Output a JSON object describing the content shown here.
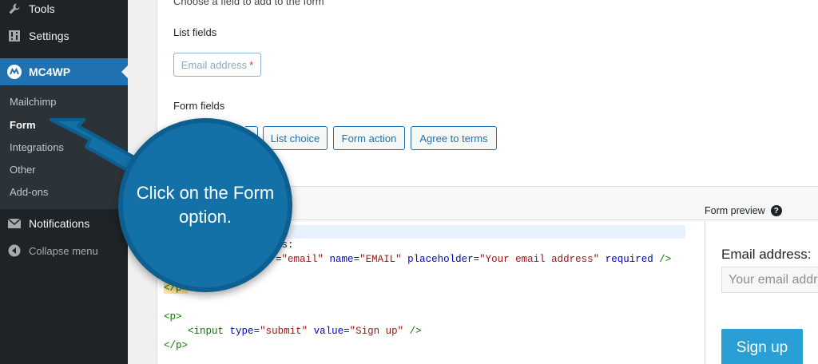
{
  "sidebar": {
    "items": [
      {
        "label": "Tools",
        "icon": "wrench-icon"
      },
      {
        "label": "Settings",
        "icon": "settings-sliders-icon"
      },
      {
        "label": "MC4WP",
        "icon": "mc4wp-logo-icon"
      },
      {
        "label": "Notifications",
        "icon": "envelope-icon"
      }
    ],
    "submenu": [
      "Mailchimp",
      "Form",
      "Integrations",
      "Other",
      "Add-ons"
    ],
    "collapse_label": "Collapse menu",
    "accent_color": "#2271b1"
  },
  "field_panel": {
    "intro": "Choose a field to add to the form",
    "list_fields_heading": "List fields",
    "list_fields": [
      {
        "label": "Email address",
        "required": true
      }
    ],
    "form_fields_heading": "Form fields",
    "form_fields": [
      "List choice",
      "Form action",
      "Agree to terms"
    ]
  },
  "editor": {
    "lines": [
      {
        "parts": [
          {
            "t": "ss:",
            "c": ""
          }
        ]
      },
      {
        "parts": [
          {
            "t": "=",
            "c": ""
          },
          {
            "t": "\"email\"",
            "c": "str"
          },
          {
            "t": " ",
            "c": ""
          },
          {
            "t": "name",
            "c": "attr"
          },
          {
            "t": "=",
            "c": ""
          },
          {
            "t": "\"EMAIL\"",
            "c": "str"
          },
          {
            "t": " ",
            "c": ""
          },
          {
            "t": "placeholder",
            "c": "attr"
          },
          {
            "t": "=",
            "c": ""
          },
          {
            "t": "\"Your email address\"",
            "c": "str"
          },
          {
            "t": " ",
            "c": ""
          },
          {
            "t": "required",
            "c": "attr"
          },
          {
            "t": " />",
            "c": "tag"
          }
        ]
      },
      {
        "parts": [
          {
            "t": "</p>",
            "c": "tag hl"
          }
        ]
      },
      {
        "parts": [
          {
            "t": "",
            "c": ""
          }
        ]
      },
      {
        "parts": [
          {
            "t": "<p>",
            "c": "tag"
          }
        ]
      },
      {
        "parts": [
          {
            "t": "    ",
            "c": ""
          },
          {
            "t": "<input",
            "c": "tag"
          },
          {
            "t": " ",
            "c": ""
          },
          {
            "t": "type",
            "c": "attr"
          },
          {
            "t": "=",
            "c": ""
          },
          {
            "t": "\"submit\"",
            "c": "str"
          },
          {
            "t": " ",
            "c": ""
          },
          {
            "t": "value",
            "c": "attr"
          },
          {
            "t": "=",
            "c": ""
          },
          {
            "t": "\"Sign up\"",
            "c": "str"
          },
          {
            "t": " />",
            "c": "tag"
          }
        ]
      },
      {
        "parts": [
          {
            "t": "</p>",
            "c": "tag"
          }
        ]
      }
    ]
  },
  "preview": {
    "title": "Form preview",
    "email_label": "Email address:",
    "email_placeholder": "Your email address",
    "submit_label": "Sign up"
  },
  "callout": {
    "text": "Click on the Form option.",
    "color": "#1471a8"
  }
}
